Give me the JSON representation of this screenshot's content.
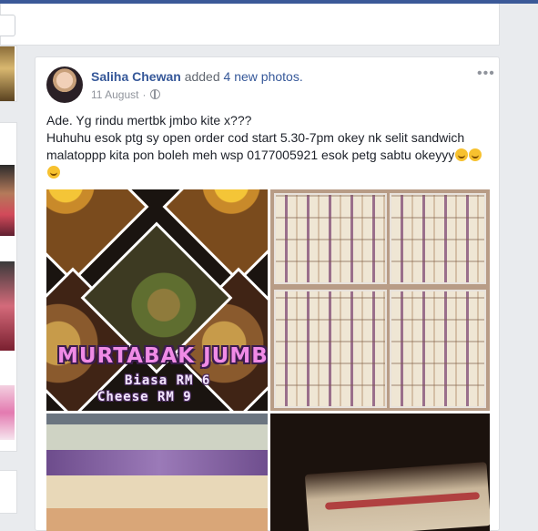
{
  "post": {
    "author": "Saliha Chewan",
    "action": "added",
    "photos_count_label": "4 new photos.",
    "date": "11 August",
    "more_label": "•••",
    "text_lines": [
      "Ade. Yg rindu mertbk jmbo kite x???",
      "Huhuhu esok ptg sy open order cod start 5.30-7pm okey nk selit sandwich malatoppp kita pon boleh meh wsp 0177005921 esok petg sabtu okeyyy"
    ],
    "icons": [
      "globe-icon",
      "smile-emoji-icon",
      "more-options-icon",
      "dropdown-icon"
    ]
  },
  "photo_1": {
    "title": "MURTABAK JUMBO",
    "price_regular": "Biasa RM 6",
    "price_cheese": "Cheese RM 9"
  },
  "colors": {
    "topbar": "#3b5998",
    "link": "#365899",
    "background": "#e9ebee",
    "banner_title": "#f08be6"
  }
}
